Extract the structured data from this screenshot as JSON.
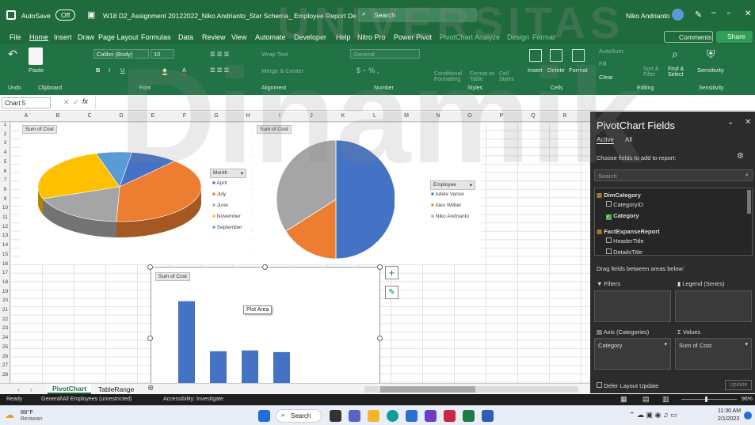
{
  "title_bar": {
    "autosave": "AutoSave",
    "autosave_state": "Off",
    "filename": "W18 D2_Assignment 20122022_Niko Andrianto_Star Schema_ Employee Report Details",
    "search": "Search",
    "user": "Niko Andrianto"
  },
  "menu": [
    "File",
    "Home",
    "Insert",
    "Draw",
    "Page Layout",
    "Formulas",
    "Data",
    "Review",
    "View",
    "Automate",
    "Developer",
    "Help",
    "Nitro Pro",
    "Power Pivot",
    "PivotChart Analyze",
    "Design",
    "Format"
  ],
  "menu_right": {
    "comments": "Comments",
    "share": "Share"
  },
  "ribbon": {
    "font_name": "Calibri (Body)",
    "font_size": "10",
    "wrap_text": "Wrap Text",
    "merge": "Merge & Center",
    "number_format": "General",
    "conditional": "Conditional Formatting",
    "format_as": "Format as Table",
    "cell_styles": "Cell Styles",
    "insert": "Insert",
    "delete": "Delete",
    "format": "Format",
    "autosum": "AutoSum",
    "fill": "Fill",
    "clear": "Clear",
    "sort": "Sort & Filter",
    "find": "Find & Select",
    "sensitivity": "Sensitivity",
    "paste": "Paste",
    "groups": [
      "Undo",
      "Clipboard",
      "Font",
      "Alignment",
      "Number",
      "Styles",
      "Cells",
      "Editing",
      "Sensitivity"
    ]
  },
  "formula_bar": {
    "name_box": "Chart 5",
    "fx": "fx"
  },
  "columns": [
    "A",
    "B",
    "C",
    "D",
    "E",
    "F",
    "G",
    "H",
    "I",
    "J",
    "K",
    "L",
    "M",
    "N",
    "O",
    "P",
    "Q",
    "R"
  ],
  "rows": [
    "1",
    "2",
    "3",
    "4",
    "5",
    "6",
    "7",
    "8",
    "9",
    "10",
    "11",
    "12",
    "13",
    "14",
    "15",
    "16",
    "17",
    "18",
    "19",
    "20",
    "21",
    "22",
    "23",
    "24",
    "25",
    "26",
    "27",
    "28"
  ],
  "chart1": {
    "field": "Sum of Cost",
    "legend_title": "Month",
    "legend": [
      {
        "label": "April",
        "color": "#4472c4"
      },
      {
        "label": "July",
        "color": "#ed7d31"
      },
      {
        "label": "June",
        "color": "#a5a5a5"
      },
      {
        "label": "November",
        "color": "#ffc000"
      },
      {
        "label": "September",
        "color": "#5b9bd5"
      }
    ]
  },
  "chart2": {
    "field": "Sum of Cost",
    "legend_title": "Employee",
    "legend": [
      {
        "label": "Adele Vance",
        "color": "#4472c4"
      },
      {
        "label": "Alex Wilber",
        "color": "#ed7d31"
      },
      {
        "label": "Niko Andrianto",
        "color": "#a5a5a5"
      }
    ]
  },
  "chart_data": [
    {
      "type": "pie",
      "title": "",
      "series": [
        {
          "name": "Sum of Cost",
          "values": [
            8,
            33,
            16,
            22,
            6
          ]
        }
      ],
      "categories": [
        "April",
        "July",
        "June",
        "November",
        "September"
      ]
    },
    {
      "type": "pie",
      "title": "",
      "series": [
        {
          "name": "Sum of Cost",
          "values": [
            50,
            16,
            34
          ]
        }
      ],
      "categories": [
        "Adele Vance",
        "Alex Wilber",
        "Niko Andrianto"
      ]
    },
    {
      "type": "bar",
      "title": "",
      "series": [
        {
          "name": "Sum of Cost",
          "values": [
            100,
            40,
            41,
            39
          ]
        }
      ],
      "categories": [
        "",
        "",
        "",
        ""
      ],
      "ylim": [
        0,
        110
      ]
    }
  ],
  "chart3": {
    "field": "Sum of Cost",
    "tooltip": "Plot Area"
  },
  "pane": {
    "title": "PivotChart Fields",
    "tab_active": "Active",
    "tab_all": "All",
    "choose": "Choose fields to add to report:",
    "search": "Search",
    "tables": [
      {
        "name": "DimCategory",
        "fields": [
          {
            "label": "CategoryID",
            "checked": false
          },
          {
            "label": "Category",
            "checked": true
          }
        ]
      },
      {
        "name": "FactExpanseReport",
        "fields": [
          {
            "label": "HeaderTitle",
            "checked": false
          },
          {
            "label": "DetailsTitle",
            "checked": false
          }
        ]
      }
    ],
    "drag": "Drag fields between areas below:",
    "filters": "Filters",
    "legend": "Legend (Series)",
    "axis": "Axis (Categories)",
    "values": "Values",
    "axis_value": "Category",
    "values_value": "Sum of Cost",
    "defer": "Defer Layout Update",
    "update": "Update"
  },
  "sheets": [
    "PivotChart",
    "TableRange"
  ],
  "status": {
    "ready": "Ready",
    "policy": "General\\All Employees (unrestricted)",
    "accessibility": "Accessibility: Investigate",
    "zoom": "96%"
  },
  "taskbar": {
    "temp": "88°F",
    "weather": "Berawan",
    "search": "Search",
    "time": "11:30 AM",
    "date": "2/1/2023"
  }
}
